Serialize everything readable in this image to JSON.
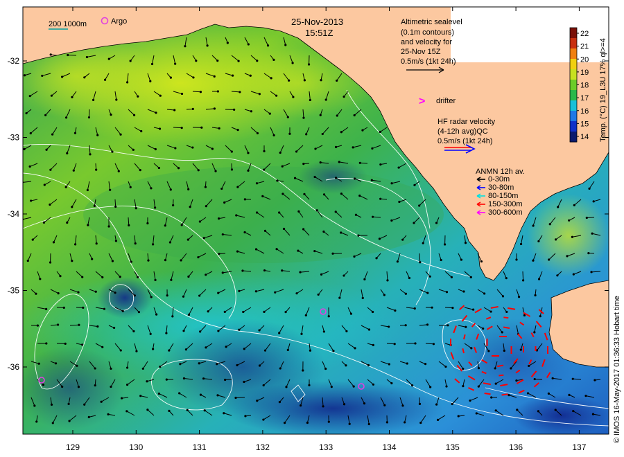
{
  "header": {
    "date": "25-Nov-2013",
    "time": "15:51Z"
  },
  "scale": {
    "label": "200  1000m",
    "argo_label": "Argo"
  },
  "altimetry": {
    "line1": "Altimetric sealevel",
    "line2": "(0.1m contours)",
    "line3": "and velocity for",
    "line4": "25-Nov 15Z",
    "line5": "0.5m/s (1kt 24h)"
  },
  "drifter": {
    "label": "drifter",
    "marker": ">"
  },
  "hf_radar": {
    "line1": "HF radar velocity",
    "line2": "(4-12h avg)QC",
    "line3": "0.5m/s (1kt 24h)"
  },
  "anmn": {
    "title": "ANMN 12h av.",
    "items": [
      {
        "label": "0-30m",
        "color": "#000000"
      },
      {
        "label": "30-80m",
        "color": "#0000ff"
      },
      {
        "label": "80-150m",
        "color": "#00e0e0"
      },
      {
        "label": "150-300m",
        "color": "#ff0000"
      },
      {
        "label": "300-600m",
        "color": "#ff00ff"
      }
    ]
  },
  "colorbar": {
    "ticks": [
      "14",
      "15",
      "16",
      "17",
      "18",
      "19",
      "20",
      "21",
      "22"
    ],
    "label": "Temp. (°C) 19_L3U 17% ql>=4",
    "colors": [
      "#0a1a6e",
      "#1030c8",
      "#1e78e6",
      "#18c0d8",
      "#2ab84a",
      "#6ccc28",
      "#c8e020",
      "#f0d010",
      "#f08010",
      "#c83010",
      "#7a1008"
    ]
  },
  "credit": "© IMOS 16-May-2017 01:36:33 Hobart time",
  "axes": {
    "lon_ticks": [
      "129",
      "130",
      "131",
      "132",
      "133",
      "134",
      "135",
      "136",
      "137"
    ],
    "lat_ticks": [
      "-32",
      "-33",
      "-34",
      "-35",
      "-36"
    ]
  },
  "map_colors": {
    "land": "#fcc8a0",
    "ocean_bg": "#2ab0a0",
    "contour": "#ffffff",
    "argo": "#e040e0",
    "drifter": "#ff00ff",
    "hf_radar_arrow": "#ff0000"
  }
}
